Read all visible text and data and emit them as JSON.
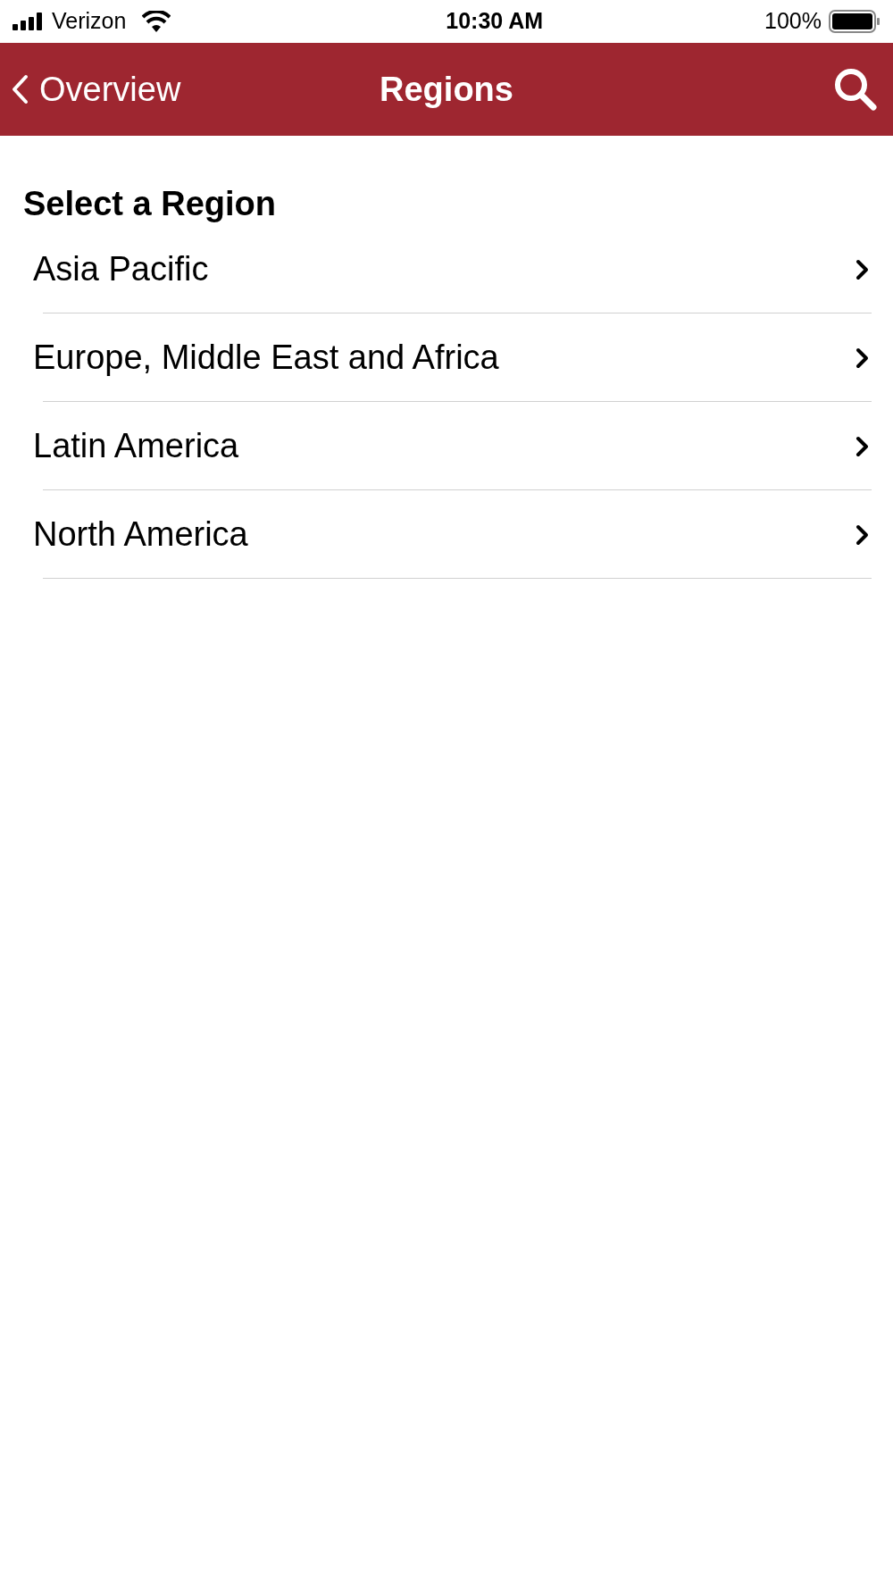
{
  "status_bar": {
    "carrier": "Verizon",
    "time": "10:30 AM",
    "battery": "100%"
  },
  "nav_bar": {
    "back": "Overview",
    "title": "Regions"
  },
  "section_title": "Select a Region",
  "regions": [
    {
      "label": "Asia Pacific"
    },
    {
      "label": "Europe, Middle East and Africa"
    },
    {
      "label": "Latin America"
    },
    {
      "label": "North America"
    }
  ]
}
